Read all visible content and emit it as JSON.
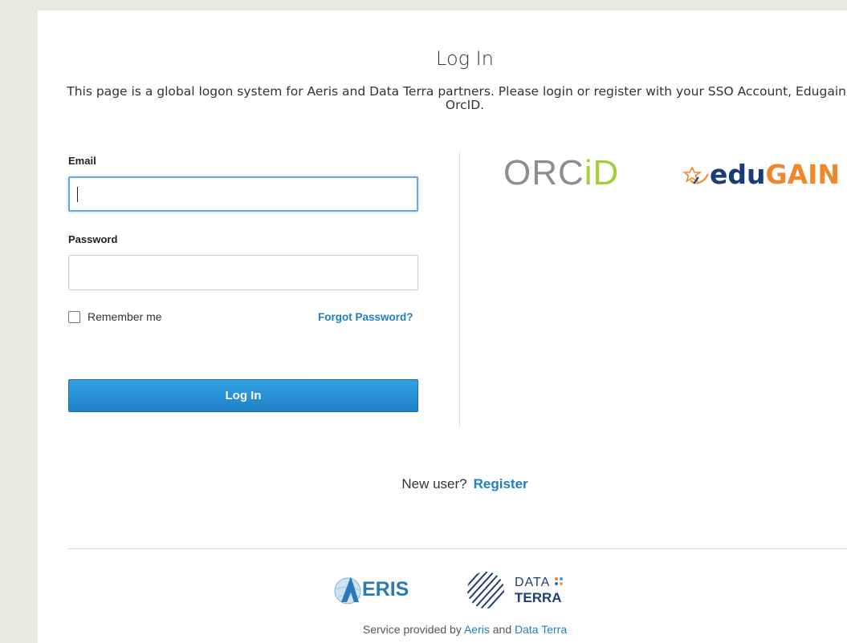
{
  "page": {
    "title": "Log In",
    "subtitle": "This page is a global logon system for Aeris and Data Terra partners. Please login or register with your SSO Account, Edugain or OrcID."
  },
  "form": {
    "email_label": "Email",
    "email_value": "",
    "password_label": "Password",
    "password_value": "",
    "remember_label": "Remember me",
    "remember_checked": false,
    "forgot_label": "Forgot Password?",
    "submit_label": "Log In"
  },
  "providers": {
    "orcid": {
      "name_main": "ORC",
      "name_accent": "iD",
      "icon": "orcid-logo"
    },
    "edugain": {
      "edu": "edu",
      "gain": "GAIN",
      "icon": "edugain-logo"
    }
  },
  "register": {
    "prompt": "New user?",
    "link_label": "Register"
  },
  "footer": {
    "aeris_logo_text": "ERIS",
    "dataterra_line1": "DATA",
    "dataterra_line2": "TERRA",
    "service_prefix": "Service provided by",
    "aeris_link": "Aeris",
    "and_text": "and",
    "dataterra_link": "Data Terra"
  },
  "colors": {
    "accent": "#1e7fc1",
    "button": "#2a90d6",
    "orcid_green": "#a6ce39",
    "edugain_orange": "#f0872a"
  }
}
